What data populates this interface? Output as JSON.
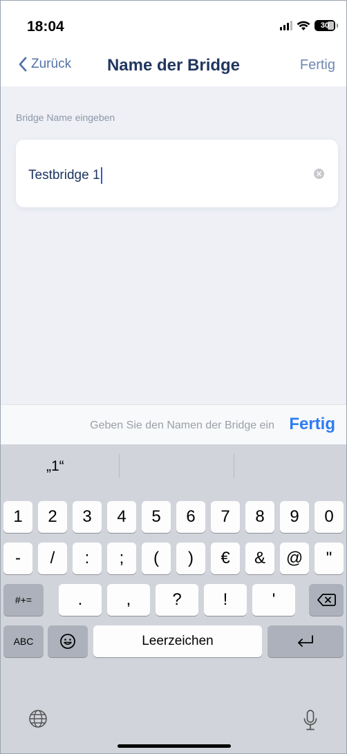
{
  "status_bar": {
    "time": "18:04",
    "battery": "30"
  },
  "nav": {
    "back_label": "Zurück",
    "title": "Name der Bridge",
    "done_label": "Fertig"
  },
  "form": {
    "field_label": "Bridge Name eingeben",
    "input_value": "Testbridge 1"
  },
  "accessory": {
    "hint": "Geben Sie den Namen der Bridge ein",
    "done_label": "Fertig"
  },
  "keyboard": {
    "suggestions": [
      "„1“",
      "",
      ""
    ],
    "row1": [
      "1",
      "2",
      "3",
      "4",
      "5",
      "6",
      "7",
      "8",
      "9",
      "0"
    ],
    "row2": [
      "-",
      "/",
      ":",
      ";",
      "(",
      ")",
      "€",
      "&",
      "@",
      "\""
    ],
    "row3_mode": "#+=",
    "row3": [
      ".",
      ",",
      "?",
      "!",
      "'"
    ],
    "abc_label": "ABC",
    "space_label": "Leerzeichen"
  },
  "colors": {
    "accent": "#2d7bf4",
    "navy": "#20375f",
    "keyboard_bg": "#d1d4db"
  }
}
